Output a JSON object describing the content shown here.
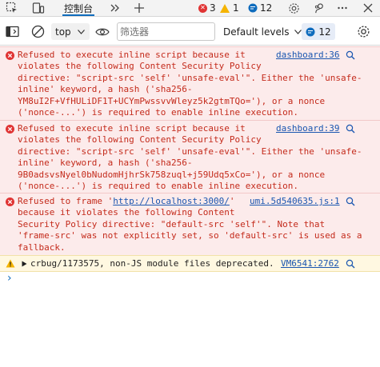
{
  "tabs": {
    "console_label": "控制台",
    "error_count": "3",
    "warning_count": "1",
    "issue_count": "12"
  },
  "toolbar": {
    "context": "top",
    "filter_placeholder": "筛选器",
    "levels_label": "Default levels",
    "issues_count": "12"
  },
  "messages": [
    {
      "level": "error",
      "lines": [
        "Refused to execute inline script because it",
        "violates the following Content Security Policy",
        "directive: \"script-src 'self' 'unsafe-eval'\". Either the 'unsafe-",
        "inline' keyword, a hash ('sha256-",
        "YM8uI2F+VfHULiDF1T+UCYmPwssvvWleyz5k2gtmTQo='), or a nonce",
        "('nonce-...') is required to enable inline execution."
      ],
      "source": "dashboard:36"
    },
    {
      "level": "error",
      "lines": [
        "Refused to execute inline script because it",
        "violates the following Content Security Policy",
        "directive: \"script-src 'self' 'unsafe-eval'\". Either the 'unsafe-",
        "inline' keyword, a hash ('sha256-",
        "9B0adsvsNyel0bNudomHjhrSk758zuql+j59Udq5xCo='), or a nonce",
        "('nonce-...') is required to enable inline execution."
      ],
      "source": "dashboard:39"
    },
    {
      "level": "error",
      "first_prefix": "Refused to frame '",
      "first_link": "http://localhost:3000/",
      "first_suffix": "'",
      "lines": [
        "because it violates the following Content",
        "Security Policy directive: \"default-src 'self'\". Note that",
        "'frame-src' was not explicitly set, so 'default-src' is used as a",
        "fallback."
      ],
      "source": "umi.5d540635.js:1"
    },
    {
      "level": "warning",
      "text": "crbug/1173575, non-JS module files deprecated.",
      "source": "VM6541:2762"
    }
  ],
  "prompt_symbol": "›",
  "icons": {
    "error": "error-circle-icon",
    "warning": "warning-triangle-icon",
    "search": "magnifier-icon"
  },
  "colors": {
    "accent": "#0f6cbd",
    "error_text": "#c42b1c",
    "error_bg": "#fcebeb",
    "warning_bg": "#fff8e1",
    "link": "#1a56b0"
  }
}
